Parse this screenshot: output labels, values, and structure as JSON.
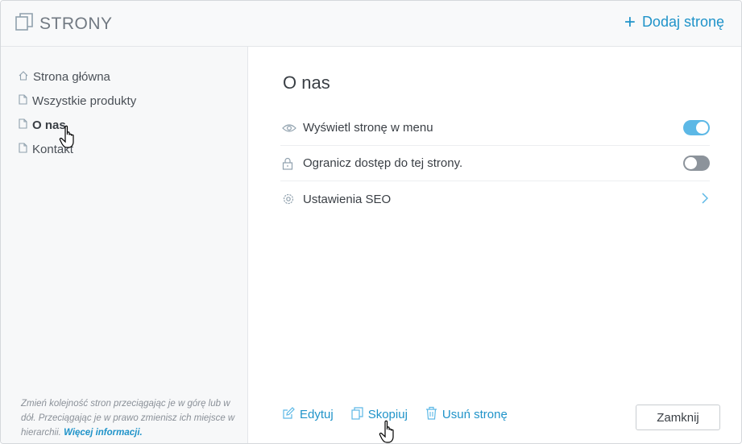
{
  "header": {
    "title": "STRONY",
    "add_page_label": "Dodaj stronę"
  },
  "sidebar": {
    "items": [
      {
        "label": "Strona główna",
        "icon": "home-icon"
      },
      {
        "label": "Wszystkie produkty",
        "icon": "page-icon"
      },
      {
        "label": "O nas",
        "icon": "page-icon",
        "active": true
      },
      {
        "label": "Kontakt",
        "icon": "page-icon"
      }
    ],
    "hint_text": "Zmień kolejność stron przeciągając je w górę lub w dół. Przeciągając je w prawo zmienisz ich miejsce w hierarchii.",
    "hint_link": "Więcej informacji."
  },
  "main": {
    "title": "O nas",
    "settings": [
      {
        "label": "Wyświetl stronę w menu",
        "icon": "eye-icon",
        "control": "toggle",
        "value": true
      },
      {
        "label": "Ogranicz dostęp do tej strony.",
        "icon": "lock-icon",
        "control": "toggle",
        "value": false
      },
      {
        "label": "Ustawienia SEO",
        "icon": "gear-icon",
        "control": "chevron"
      }
    ]
  },
  "footer": {
    "edit_label": "Edytuj",
    "copy_label": "Skopiuj",
    "delete_label": "Usuń stronę",
    "close_label": "Zamknij"
  },
  "colors": {
    "accent": "#1f93c9",
    "toggle_on": "#5cb8e6",
    "toggle_off": "#8c939b"
  }
}
